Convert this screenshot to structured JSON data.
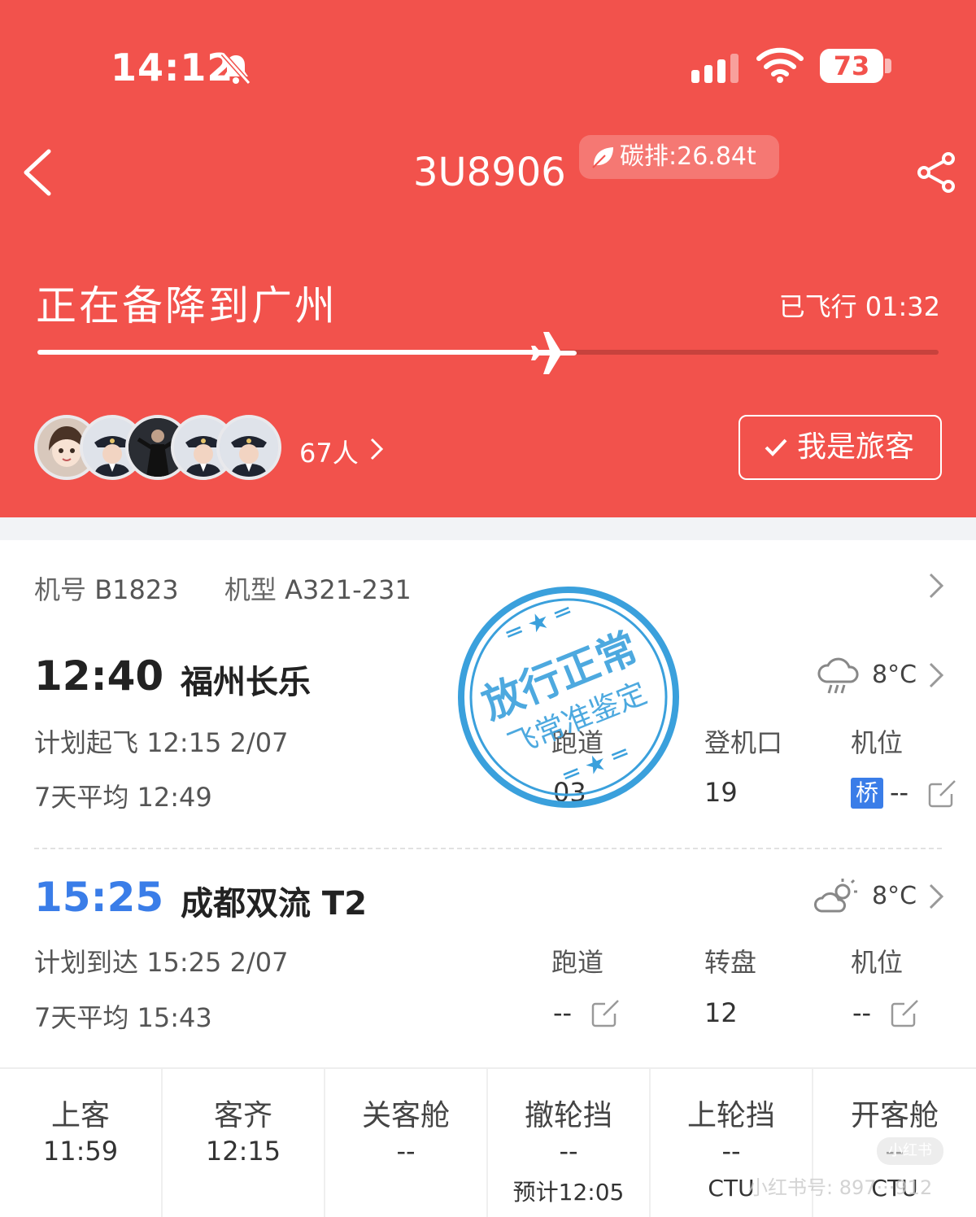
{
  "status_bar": {
    "time": "14:12",
    "battery": "73"
  },
  "header": {
    "flight_number": "3U8906",
    "carbon_label": "碳排:26.84t",
    "status_text": "正在备降到广州",
    "flown_label": "已飞行",
    "flown_time": "01:32",
    "progress_fraction": 0.58,
    "passenger_count": "67人",
    "passenger_button": "我是旅客"
  },
  "aircraft": {
    "reg_label": "机号",
    "reg_value": "B1823",
    "type_label": "机型",
    "type_value": "A321-231"
  },
  "departure": {
    "time": "12:40",
    "airport": "福州长乐",
    "temp": "8°C",
    "sched_label": "计划起飞",
    "sched_value": "12:15 2/07",
    "avg_label": "7天平均",
    "avg_value": "12:49",
    "runway_label": "跑道",
    "runway_value": "03",
    "gate_label": "登机口",
    "gate_value": "19",
    "stand_label": "机位",
    "stand_badge": "桥",
    "stand_value": "--"
  },
  "arrival": {
    "time": "15:25",
    "airport": "成都双流 T2",
    "temp": "8°C",
    "sched_label": "计划到达",
    "sched_value": "15:25 2/07",
    "avg_label": "7天平均",
    "avg_value": "15:43",
    "runway_label": "跑道",
    "runway_value": "--",
    "carousel_label": "转盘",
    "carousel_value": "12",
    "stand_label": "机位",
    "stand_value": "--"
  },
  "stamp": {
    "main": "放行正常",
    "sub": "飞常准鉴定"
  },
  "milestones": [
    {
      "label": "上客",
      "time": "11:59",
      "note": ""
    },
    {
      "label": "客齐",
      "time": "12:15",
      "note": ""
    },
    {
      "label": "关客舱",
      "time": "--",
      "note": ""
    },
    {
      "label": "撤轮挡",
      "time": "--",
      "note": "预计12:05"
    },
    {
      "label": "上轮挡",
      "time": "--",
      "note": "CTU"
    },
    {
      "label": "开客舱",
      "time": "--",
      "note": "CTU"
    }
  ],
  "watermark": {
    "logo": "小红书",
    "id": "小红书号: 897···912"
  },
  "colors": {
    "header": "#f2524c",
    "accent_blue": "#3a7de8",
    "stamp": "#3aa0dc"
  }
}
